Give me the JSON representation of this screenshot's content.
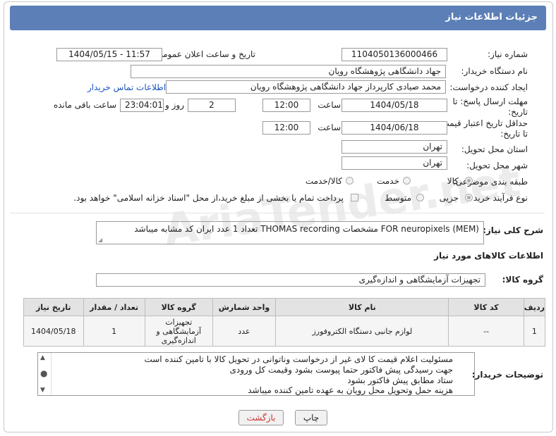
{
  "header": {
    "title": "جزئیات اطلاعات نیاز"
  },
  "fields": {
    "need_number_label": "شماره نیاز:",
    "need_number": "1104050136000466",
    "announce_label": "تاریخ و ساعت اعلان عمومی:",
    "announce_value": "1404/05/15 - 11:57",
    "buyer_org_label": "نام دستگاه خریدار:",
    "buyer_org": "جهاد دانشگاهی پژوهشگاه رویان",
    "creator_label": "ایجاد کننده درخواست:",
    "creator": "محمد صیادی کارپرداز جهاد دانشگاهی پژوهشگاه رویان",
    "contact_link": "اطلاعات تماس خریدار",
    "deadline_label_1": "مهلت ارسال پاسخ: تا",
    "deadline_label_2": "تاریخ:",
    "deadline_date": "1404/05/18",
    "time_label": "ساعت",
    "deadline_time": "12:00",
    "days_value": "2",
    "days_label": "روز و",
    "remaining_time": "23:04:01",
    "remaining_label": "ساعت باقی مانده",
    "validity_label_1": "حداقل تاریخ اعتبار قیمت:",
    "validity_label_2": "تا تاریخ:",
    "validity_date": "1404/06/18",
    "validity_time": "12:00",
    "province_label": "استان محل تحویل:",
    "province": "تهران",
    "city_label": "شهر محل تحویل:",
    "city": "تهران",
    "category_label": "طبقه بندی موضوعی:",
    "category_options": [
      "کالا",
      "خدمت",
      "کالا/خدمت"
    ],
    "process_label": "نوع فرآیند خرید :",
    "process_options": [
      "جزیی",
      "متوسط"
    ],
    "payment_note": "پرداخت تمام یا بخشی از مبلغ خرید،از محل \"اسناد خزانه اسلامی\" خواهد بود.",
    "summary_label": "شرح کلی نیاز:",
    "summary": "FOR neuropixels (MEM) مشخصات THOMAS recording تعداد 1 عدد   ایران کد مشابه میباشد",
    "goods_info_title": "اطلاعات کالاهای مورد نیاز",
    "goods_group_label": "گروه کالا:",
    "goods_group": "تجهیزات آزمایشگاهی و اندازه‌گیری"
  },
  "table": {
    "headers": [
      "ردیف",
      "کد کالا",
      "نام کالا",
      "واحد شمارش",
      "گروه کالا",
      "تعداد / مقدار",
      "تاریخ نیاز"
    ],
    "rows": [
      [
        "1",
        "--",
        "لوازم جانبی دستگاه الکتروفورز",
        "عدد",
        "تجهیزات آزمایشگاهی و اندازه‌گیری",
        "1",
        "1404/05/18"
      ]
    ]
  },
  "notes": {
    "label": "توضیحات خریدار:",
    "lines": [
      "مسئولیت اعلام قیمت کا لای  غیر از درخواست وناتوانی در تحویل کالا با تامین کننده است",
      "جهت رسیدگی پیش فاکتور حتما پیوست بشود وقیمت کل ورودی",
      "ستاد مطابق پیش فاکتور بشود",
      "هزینه حمل وتحویل محل رویان به عهده تامین کننده میباشد"
    ]
  },
  "buttons": {
    "print": "چاپ",
    "back": "بازگشت"
  },
  "watermark": "AriaTender.net"
}
